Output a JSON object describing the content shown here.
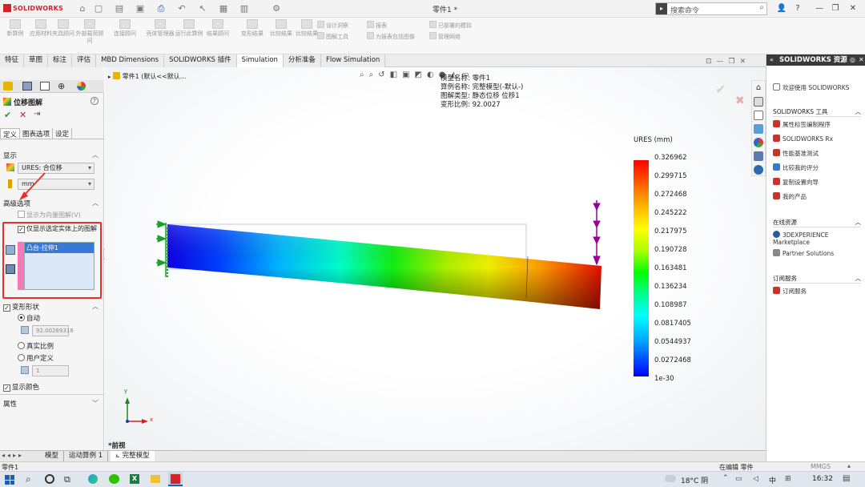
{
  "app": {
    "logo": "SOLIDWORKS",
    "doc_title": "零件1 *"
  },
  "search": {
    "placeholder": "搜索命令"
  },
  "ribbon": {
    "buttons": [
      "新算例",
      "应用材料",
      "夹具顾问",
      "外部载荷顾问",
      "连接顾问",
      "壳体管理器",
      "运行此算例",
      "结果顾问",
      "变形结果",
      "比较结果"
    ],
    "small": [
      "设计洞察",
      "图解工具",
      "报表",
      "为报表包括图像",
      "已部署的模拟",
      "管理网络"
    ]
  },
  "tabs": [
    "特征",
    "草图",
    "标注",
    "评估",
    "MBD Dimensions",
    "SOLIDWORKS 插件",
    "Simulation",
    "分析准备",
    "Flow Simulation"
  ],
  "panel": {
    "title": "位移图解",
    "subtabs": [
      "定义",
      "图表选项",
      "设定"
    ],
    "display_label": "显示",
    "component": "URES: 合位移",
    "unit": "mm",
    "advanced_label": "高级选项",
    "vector_option": "显示为向量图解(V)",
    "selected_only": "仅显示选定实体上的图解",
    "selected_item": "凸台-拉伸1",
    "deformed_label": "变形形状",
    "auto_label": "自动",
    "auto_value": "92.00269318",
    "true_scale": "真实比例",
    "user_defined": "用户定义",
    "user_value": "1",
    "show_color": "显示颜色",
    "property_label": "属性"
  },
  "viewport": {
    "tree_item": "零件1 (默认<<默认...",
    "info": [
      "模型名称: 零件1",
      "算例名称: 完整模型(-默认-)",
      "图解类型: 静态位移 位移1",
      "变形比例: 92.0027"
    ],
    "view_label": "*前视"
  },
  "legend": {
    "title": "URES (mm)",
    "ticks": [
      "0.326962",
      "0.299715",
      "0.272468",
      "0.245222",
      "0.217975",
      "0.190728",
      "0.163481",
      "0.136234",
      "0.108987",
      "0.0817405",
      "0.0544937",
      "0.0272468",
      "1e-30"
    ]
  },
  "right_panel": {
    "title": "SOLIDWORKS 资源",
    "welcome": "欢迎使用 SOLIDWORKS",
    "tools_header": "SOLIDWORKS 工具",
    "tools": [
      "属性标签编制程序",
      "SOLIDWORKS Rx",
      "性能基准测试",
      "比较我的评分",
      "复制设置向导",
      "我的产品"
    ],
    "online_header": "在线资源",
    "online": [
      "3DEXPERIENCE Marketplace",
      "Partner Solutions"
    ],
    "sub_header": "订阅服务",
    "sub": [
      "订阅服务"
    ]
  },
  "bottom_tabs": [
    "模型",
    "运动算例 1",
    "完整模型"
  ],
  "status": {
    "left": "零件1",
    "editing": "在编辑 零件",
    "units": "MMGS"
  },
  "taskbar": {
    "weather": "18°C 阴",
    "lang": "中",
    "time": "16:32"
  }
}
